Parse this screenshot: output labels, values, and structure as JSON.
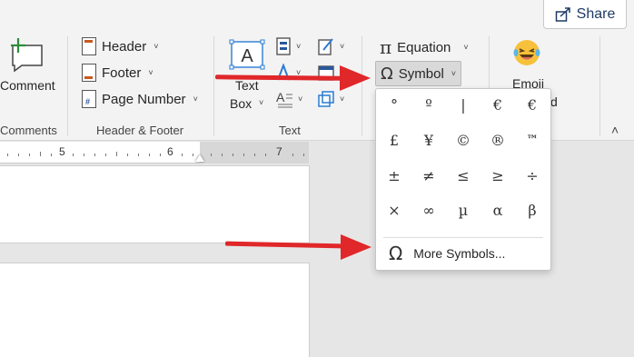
{
  "share": {
    "label": "Share"
  },
  "comments": {
    "button": "Comment",
    "group": "Comments"
  },
  "header_footer": {
    "items": [
      "Header",
      "Footer",
      "Page Number"
    ],
    "group": "Header & Footer"
  },
  "text": {
    "text_box_line1": "Text",
    "text_box_line2": "Box",
    "group": "Text"
  },
  "symbols": {
    "equation": "Equation",
    "symbol": "Symbol",
    "emoji": "Emoji",
    "emoji_clipped": "d"
  },
  "ruler": {
    "numbers": [
      "5",
      "6",
      "7"
    ]
  },
  "symbol_dropdown": {
    "grid": [
      "°",
      "º",
      "|",
      "€",
      "€",
      "£",
      "¥",
      "©",
      "®",
      "™",
      "±",
      "≠",
      "≤",
      "≥",
      "÷",
      "×",
      "∞",
      "µ",
      "α",
      "β"
    ],
    "more_symbols": "More Symbols..."
  },
  "colors": {
    "arrow": "#e0272a",
    "accent": "#2b579a"
  }
}
